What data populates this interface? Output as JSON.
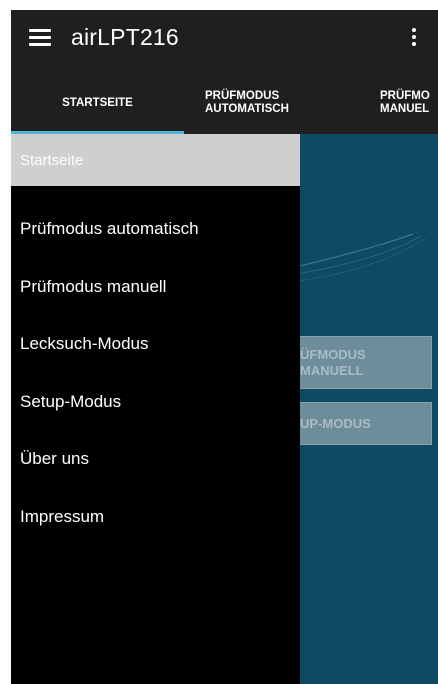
{
  "appbar": {
    "title": "airLPT216"
  },
  "tabs": [
    {
      "label": "STARTSEITE",
      "active": true
    },
    {
      "label": "PRÜFMODUS AUTOMATISCH",
      "active": false
    },
    {
      "label": "PRÜFMO MANUEL",
      "active": false
    }
  ],
  "content": {
    "buttons": [
      {
        "label": "ÜFMODUS\nMANUELL"
      },
      {
        "label": "UP-MODUS"
      }
    ]
  },
  "drawer": {
    "items": [
      {
        "label": "Startseite",
        "active": true
      },
      {
        "label": "Prüfmodus automatisch"
      },
      {
        "label": "Prüfmodus manuell"
      },
      {
        "label": "Lecksuch-Modus"
      },
      {
        "label": "Setup-Modus"
      },
      {
        "label": "Über uns"
      },
      {
        "label": "Impressum"
      }
    ]
  },
  "colors": {
    "appbar": "#1f1f1f",
    "accent": "#4fb8d8",
    "content_bg": "#0f4a63",
    "drawer_bg": "#000000",
    "drawer_active_bg": "#cfcfcf"
  }
}
